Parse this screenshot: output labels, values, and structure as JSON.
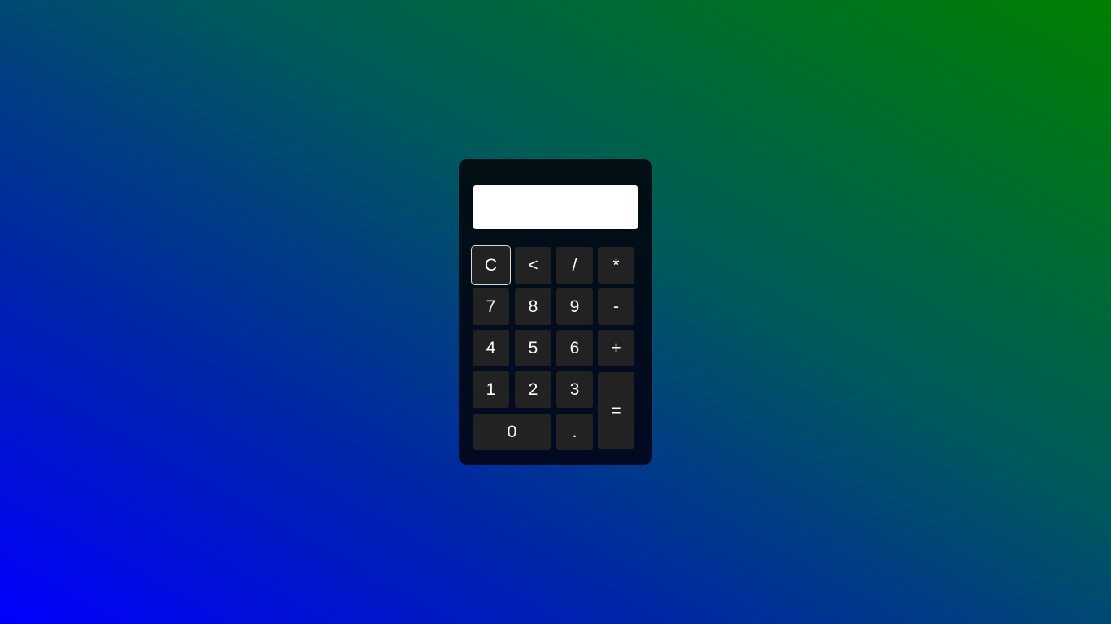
{
  "page": {
    "background_from": "#0000ff",
    "background_to": "#008000"
  },
  "calculator": {
    "display": {
      "value": "",
      "placeholder": ""
    },
    "keys": {
      "clear": "C",
      "backspace": "<",
      "divide": "/",
      "multiply": "*",
      "seven": "7",
      "eight": "8",
      "nine": "9",
      "subtract": "-",
      "four": "4",
      "five": "5",
      "six": "6",
      "add": "+",
      "one": "1",
      "two": "2",
      "three": "3",
      "equals": "=",
      "zero": "0",
      "decimal": "."
    },
    "colors": {
      "body": "#020c1a",
      "key": "#222222",
      "key_text": "#ffffff",
      "display": "#ffffff"
    }
  }
}
